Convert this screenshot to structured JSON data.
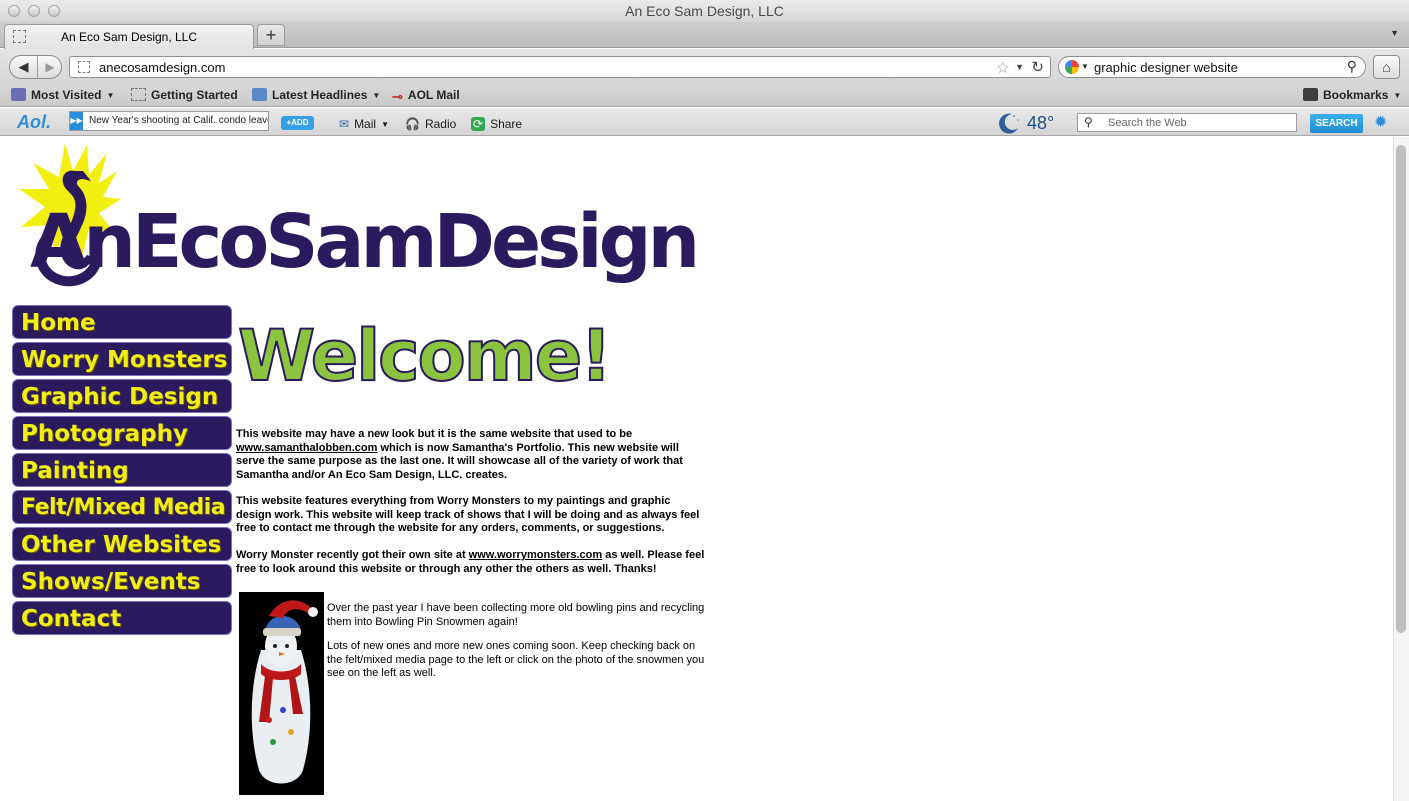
{
  "window": {
    "title": "An Eco Sam Design, LLC"
  },
  "tabs": [
    {
      "label": "An Eco Sam Design, LLC"
    }
  ],
  "newtab_label": "+",
  "address": {
    "url": "anecosamdesign.com"
  },
  "search": {
    "query": "graphic designer website"
  },
  "bookmarks": {
    "items": [
      {
        "label": "Most Visited"
      },
      {
        "label": "Getting Started"
      },
      {
        "label": "Latest Headlines"
      },
      {
        "label": "AOL Mail"
      }
    ],
    "right_label": "Bookmarks"
  },
  "aol_toolbar": {
    "logo": "Aol.",
    "ticker": "New Year's shooting at Calif. condo leaves",
    "add_label": "+ADD",
    "mail_label": "Mail",
    "radio_label": "Radio",
    "share_label": "Share",
    "temperature": "48°",
    "search_placeholder": "Search the Web",
    "search_button": "SEARCH"
  },
  "site": {
    "logo_text": "AnEcoSamDesign",
    "nav": [
      {
        "label": "Home"
      },
      {
        "label": "Worry Monsters"
      },
      {
        "label": "Graphic Design"
      },
      {
        "label": "Photography"
      },
      {
        "label": "Painting"
      },
      {
        "label": "Felt/Mixed Media"
      },
      {
        "label": "Other Websites"
      },
      {
        "label": "Shows/Events"
      },
      {
        "label": "Contact"
      }
    ],
    "welcome": "Welcome!",
    "p1": {
      "before": "This website may have a new look but it is the same website that used to be ",
      "link": "www.samanthalobben.com",
      "after": " which is now Samantha's Portfolio. This new website will serve the same purpose as the last one. It will showcase all of the variety of work that Samantha and/or An Eco Sam Design, LLC. creates."
    },
    "p2": "This website features everything from Worry Monsters to my paintings and graphic design work. This website will keep track of shows that I will be doing and as always feel free to contact me through the website for any orders, comments, or suggestions.",
    "p3": {
      "before": "Worry Monster recently got their own site at ",
      "link": "www.worrymonsters.com",
      "after": " as well. Please feel free to look around this website or through any other the others as well. Thanks!"
    },
    "snow1": "Over the past year I have been collecting more old bowling pins and recycling them into Bowling Pin Snowmen again!",
    "snow2": "Lots of new ones and more new ones coming soon. Keep checking back on the felt/mixed media page to the left or click on the photo of the snowmen you see on the left as well."
  }
}
